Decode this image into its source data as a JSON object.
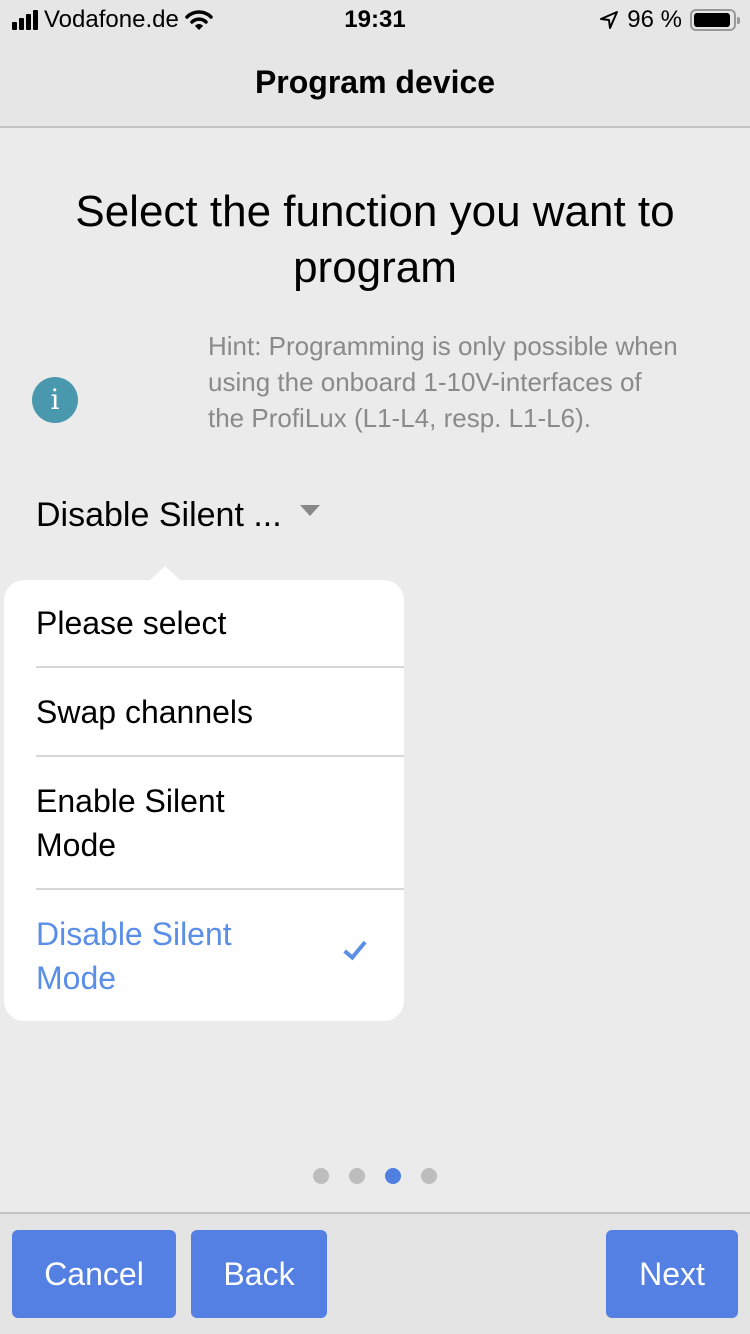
{
  "status_bar": {
    "carrier": "Vodafone.de",
    "time": "19:31",
    "battery_percent": "96 %",
    "battery_level": 0.96,
    "icons": [
      "signal-icon",
      "wifi-icon",
      "location-arrow-icon",
      "battery-icon"
    ]
  },
  "nav": {
    "title": "Program device"
  },
  "main": {
    "heading": "Select the function you want to program",
    "hint": "Hint: Programming is only possible when using the onboard 1-10V-interfaces of the ProfiLux (L1-L4, resp. L1-L6).",
    "info_icon_glyph": "i",
    "select": {
      "value": "Disable Silent ...",
      "options": [
        {
          "label": "Please select",
          "selected": false
        },
        {
          "label": "Swap channels",
          "selected": false
        },
        {
          "label": "Enable Silent Mode",
          "selected": false
        },
        {
          "label": "Disable Silent Mode",
          "selected": true
        }
      ]
    }
  },
  "pager": {
    "total": 4,
    "current": 3
  },
  "footer": {
    "cancel_label": "Cancel",
    "back_label": "Back",
    "next_label": "Next"
  },
  "colors": {
    "accent": "#5380e2",
    "selected_text": "#5b8ee6",
    "info_icon": "#4a98ad",
    "hint_text": "#8a8a8a"
  }
}
